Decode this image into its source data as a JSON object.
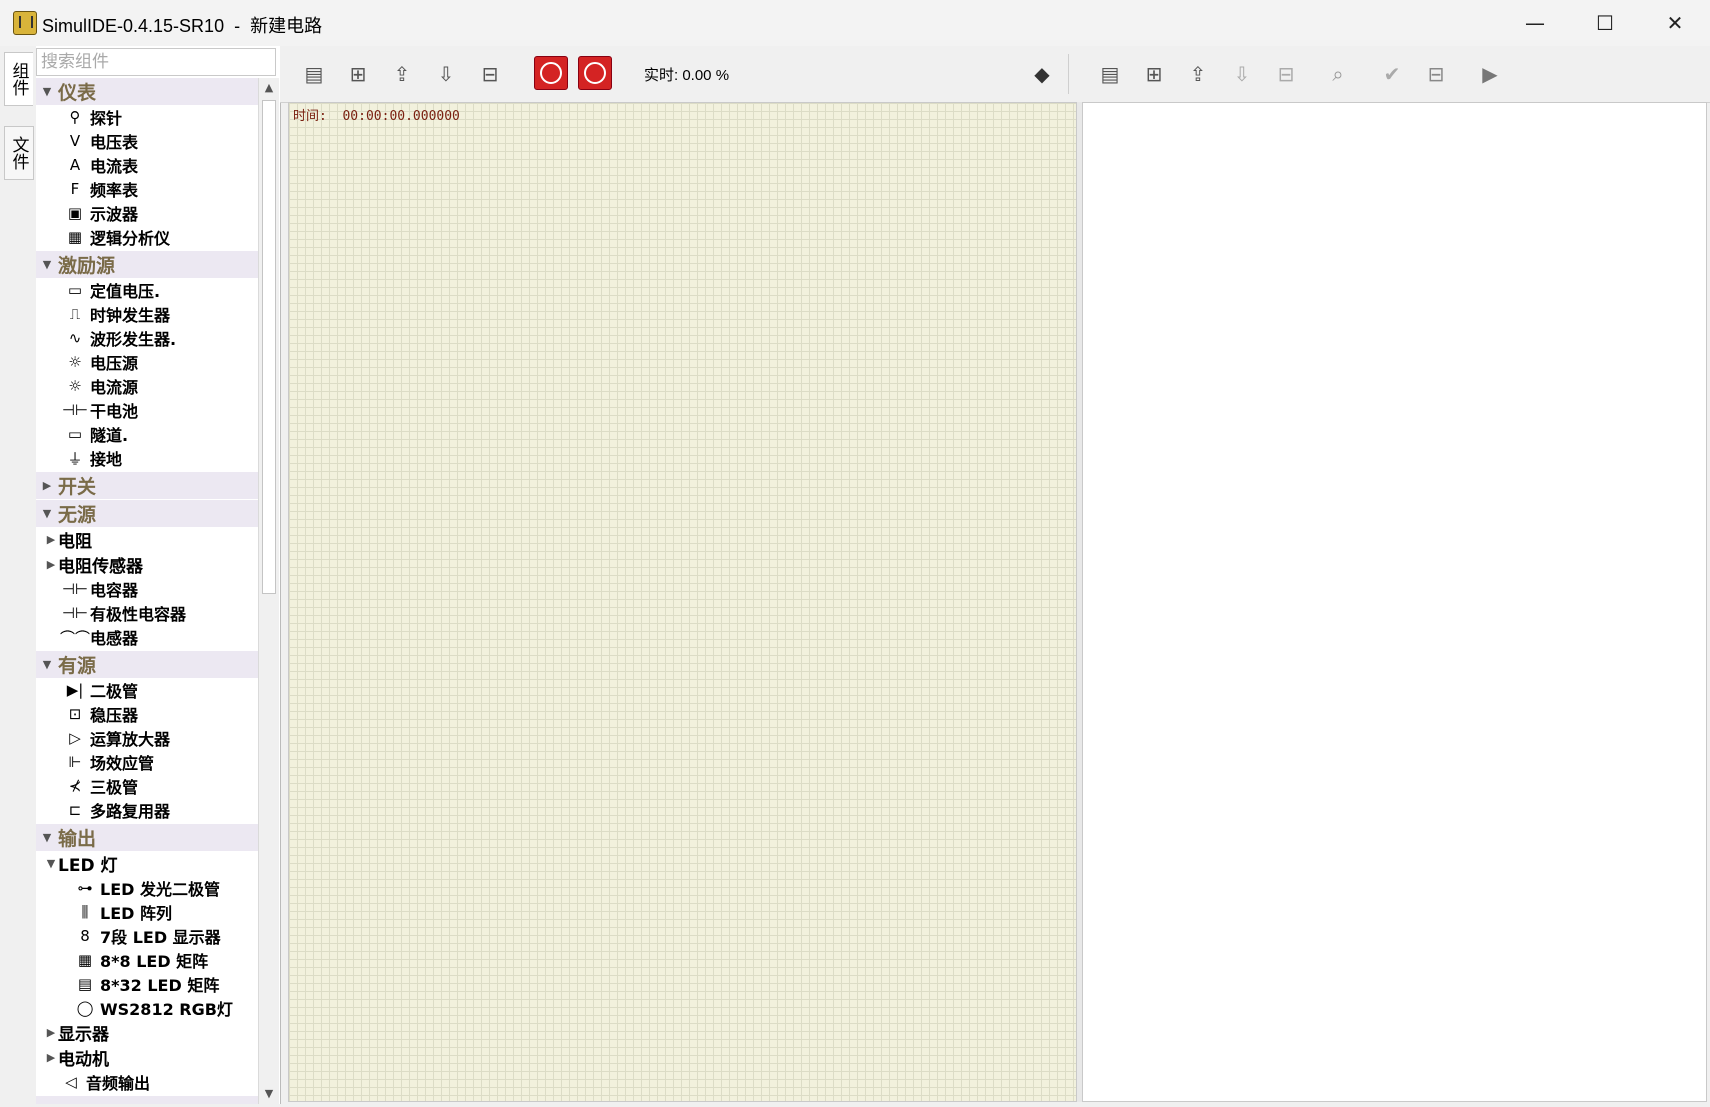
{
  "window": {
    "app_title": "SimulIDE-0.4.15-SR10",
    "title_sep": "  -  ",
    "doc_title": "新建电路",
    "minimize_glyph": "—",
    "maximize_glyph": "☐",
    "close_glyph": "✕"
  },
  "side_tabs": {
    "components": "组件",
    "files": "文件"
  },
  "search": {
    "placeholder": "搜索组件"
  },
  "tree": {
    "instruments": {
      "label": "仪表",
      "items": [
        "探针",
        "电压表",
        "电流表",
        "频率表",
        "示波器",
        "逻辑分析仪"
      ],
      "icons": [
        "⚲",
        "V",
        "A",
        "F",
        "▣",
        "▦"
      ]
    },
    "sources": {
      "label": "激励源",
      "items": [
        "定值电压.",
        "时钟发生器",
        "波形发生器.",
        "电压源",
        "电流源",
        "干电池",
        "隧道.",
        "接地"
      ],
      "icons": [
        "▭",
        "⎍",
        "∿",
        "☼",
        "☼",
        "⊣⊢",
        "▭",
        "⏚"
      ]
    },
    "switches": {
      "label": "开关"
    },
    "passive": {
      "label": "无源",
      "subs": [
        "电阻",
        "电阻传感器"
      ],
      "items": [
        "电容器",
        "有极性电容器",
        "电感器"
      ],
      "icons": [
        "⊣⊢",
        "⊣⊢",
        "⌒⌒"
      ]
    },
    "active": {
      "label": "有源",
      "items": [
        "二极管",
        "稳压器",
        "运算放大器",
        "场效应管",
        "三极管",
        "多路复用器"
      ],
      "icons": [
        "▶|",
        "⊡",
        "▷",
        "⊩",
        "⊀",
        "⊏"
      ]
    },
    "output": {
      "label": "输出",
      "led_group": "LED 灯",
      "led_items": [
        "LED 发光二极管",
        "LED 阵列",
        "7段 LED 显示器",
        "8*8 LED 矩阵",
        "8*32 LED 矩阵",
        "WS2812 RGB灯"
      ],
      "led_icons": [
        "⊶",
        "⫼",
        "8",
        "▦",
        "▤",
        "◯"
      ],
      "subs": [
        "显示器",
        "电动机"
      ],
      "audio": "音频输出",
      "audio_icon": "◁"
    }
  },
  "toolbar": {
    "realtime": "实时: 0.00 %"
  },
  "canvas": {
    "time_label": "时间:  00:00:00.000000"
  }
}
